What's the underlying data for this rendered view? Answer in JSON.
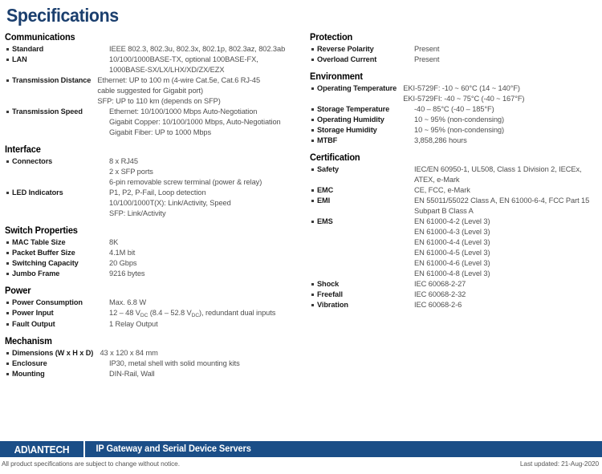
{
  "page": {
    "title": "Specifications"
  },
  "left_column": [
    {
      "heading": "Communications",
      "rows": [
        {
          "label": "Standard",
          "values": [
            "IEEE 802.3, 802.3u, 802.3x, 802.1p, 802.3az, 802.3ab"
          ]
        },
        {
          "label": "LAN",
          "values": [
            "10/100/1000BASE-TX, optional 100BASE-FX,",
            "1000BASE-SX/LX/LHX/XD/ZX/EZX"
          ]
        },
        {
          "label": "Transmission Distance",
          "wide": true,
          "values": [
            "Ethernet: UP to 100 m (4-wire Cat.5e, Cat.6 RJ-45",
            "cable suggested for Gigabit port)",
            "SFP: UP to 110 km (depends on SFP)"
          ]
        },
        {
          "label": "Transmission Speed",
          "values": [
            "Ethernet: 10/100/1000 Mbps Auto-Negotiation",
            "Gigabit Copper: 10/100/1000 Mbps, Auto-Negotiation",
            "Gigabit Fiber: UP to 1000 Mbps"
          ]
        }
      ]
    },
    {
      "heading": "Interface",
      "rows": [
        {
          "label": "Connectors",
          "values": [
            "8 x RJ45",
            "2 x SFP ports",
            "6-pin removable screw terminal (power & relay)"
          ]
        },
        {
          "label": "LED Indicators",
          "values": [
            "P1, P2, P-Fail, Loop detection",
            "10/100/1000T(X): Link/Activity, Speed",
            "SFP: Link/Activity"
          ]
        }
      ]
    },
    {
      "heading": "Switch Properties",
      "rows": [
        {
          "label": "MAC Table Size",
          "values": [
            "8K"
          ]
        },
        {
          "label": "Packet Buffer Size",
          "values": [
            "4.1M bit"
          ]
        },
        {
          "label": "Switching Capacity",
          "values": [
            "20 Gbps"
          ]
        },
        {
          "label": "Jumbo Frame",
          "values": [
            "9216 bytes"
          ]
        }
      ]
    },
    {
      "heading": "Power",
      "rows": [
        {
          "label": "Power Consumption",
          "values": [
            "Max. 6.8 W"
          ]
        },
        {
          "label": "Power Input",
          "html_values": [
            "12 – 48 V<sub>DC</sub> (8.4 – 52.8 V<sub>DC</sub>), redundant dual inputs"
          ]
        },
        {
          "label": "Fault Output",
          "values": [
            "1 Relay Output"
          ]
        }
      ]
    },
    {
      "heading": "Mechanism",
      "rows": [
        {
          "label": "Dimensions (W x H x D)",
          "wide": true,
          "values": [
            "43 x 120 x 84 mm"
          ]
        },
        {
          "label": "Enclosure",
          "values": [
            "IP30, metal shell with solid mounting kits"
          ]
        },
        {
          "label": "Mounting",
          "values": [
            "DIN-Rail, Wall"
          ]
        }
      ]
    }
  ],
  "right_column": [
    {
      "heading": "Protection",
      "rows": [
        {
          "label": "Reverse Polarity",
          "values": [
            "Present"
          ]
        },
        {
          "label": "Overload Current",
          "values": [
            "Present"
          ]
        }
      ]
    },
    {
      "heading": "Environment",
      "rows": [
        {
          "label": "Operating Temperature",
          "wide": true,
          "values": [
            "EKI-5729F: -10 ~ 60°C (14 ~ 140°F)",
            "EKI-5729FI: -40 ~ 75°C (-40 ~ 167°F)"
          ]
        },
        {
          "label": "Storage Temperature",
          "values": [
            "-40 – 85°C (-40 – 185°F)"
          ]
        },
        {
          "label": "Operating Humidity",
          "values": [
            "10 ~ 95% (non-condensing)"
          ]
        },
        {
          "label": "Storage Humidity",
          "values": [
            "10 ~ 95% (non-condensing)"
          ]
        },
        {
          "label": "MTBF",
          "values": [
            "3,858,286 hours"
          ]
        }
      ]
    },
    {
      "heading": "Certification",
      "rows": [
        {
          "label": "Safety",
          "values": [
            "IEC/EN 60950-1, UL508, Class 1 Division 2, IECEx,",
            "ATEX, e-Mark"
          ]
        },
        {
          "label": "EMC",
          "values": [
            "CE, FCC, e-Mark"
          ]
        },
        {
          "label": "EMI",
          "values": [
            "EN 55011/55022 Class A, EN 61000-6-4, FCC Part 15",
            "Subpart B Class A"
          ]
        },
        {
          "label": "EMS",
          "values": [
            "EN 61000-4-2 (Level 3)",
            "EN 61000-4-3 (Level 3)",
            "EN 61000-4-4 (Level 3)",
            "EN 61000-4-5 (Level 3)",
            "EN 61000-4-6 (Level 3)",
            "EN 61000-4-8 (Level 3)"
          ]
        },
        {
          "label": "Shock",
          "values": [
            "IEC 60068-2-27"
          ]
        },
        {
          "label": "Freefall",
          "values": [
            "IEC 60068-2-32"
          ]
        },
        {
          "label": "Vibration",
          "values": [
            "IEC 60068-2-6"
          ]
        }
      ]
    }
  ],
  "footer": {
    "logo_text": "AD\\ANTECH",
    "product_line": "IP Gateway and Serial Device Servers",
    "disclaimer": "All product specifications are subject to change without notice.",
    "last_updated": "Last updated: 21-Aug-2020",
    "bar_color": "#1b4e87"
  }
}
